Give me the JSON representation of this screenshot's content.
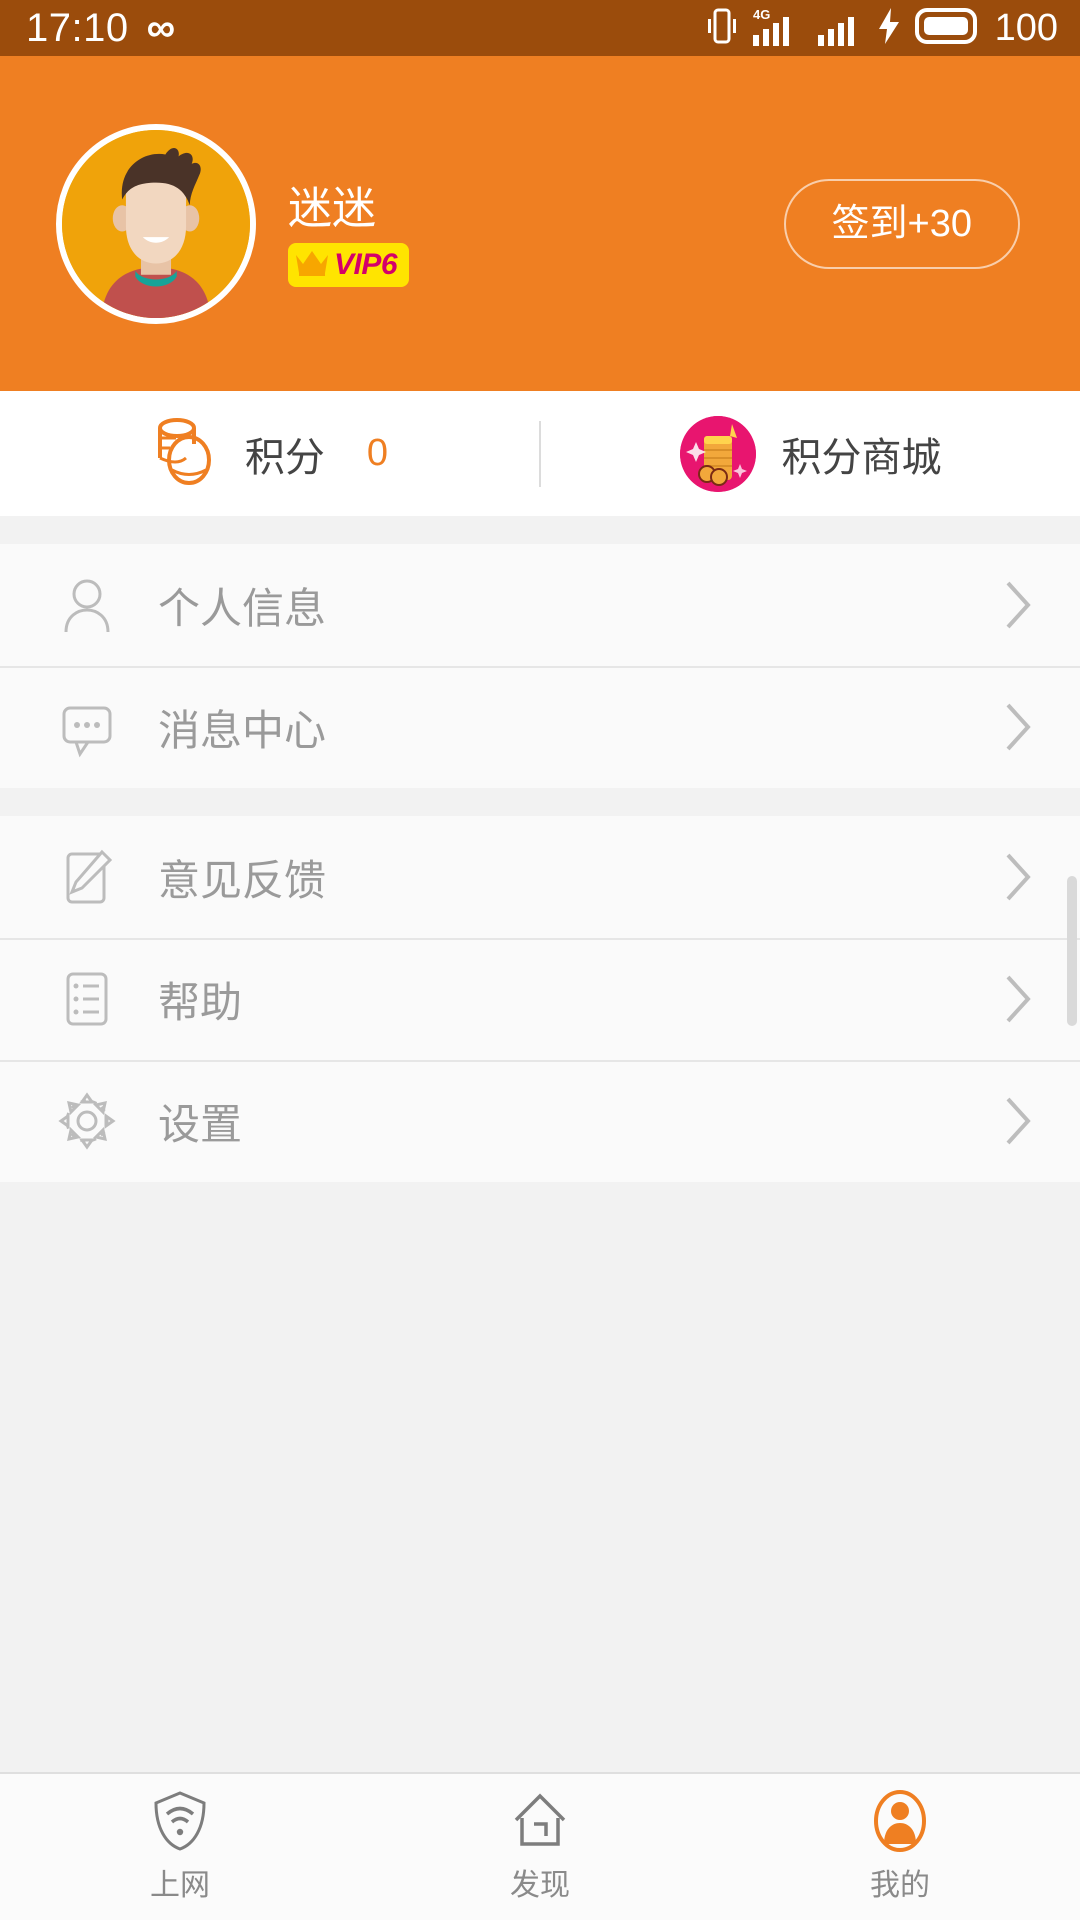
{
  "statusbar": {
    "time": "17:10",
    "infinity_icon": "infinity-icon",
    "vibrate_icon": "vibrate-icon",
    "signal_4g_icon": "signal-4g-icon",
    "signal_icon": "signal-bars-icon",
    "charging_icon": "charging-bolt-icon",
    "battery_icon": "battery-icon",
    "battery_level": "100",
    "bg_color": "#9b4c0c"
  },
  "profile": {
    "bg_color": "#ef7f22",
    "avatar_name": "user-avatar",
    "username": "迷迷",
    "vip": {
      "label": "VIP6",
      "crown_icon": "crown-icon",
      "bg_color": "#ffe400",
      "text_color": "#d4006a"
    },
    "checkin_label": "签到+30"
  },
  "points": {
    "coins_icon": "coins-icon",
    "label": "积分",
    "value": "0",
    "value_color": "#ef7f22",
    "mall_icon": "points-mall-icon",
    "mall_label": "积分商城"
  },
  "menu": {
    "groups": [
      {
        "items": [
          {
            "icon": "person-icon",
            "label": "个人信息",
            "chevron": "chevron-right-icon"
          },
          {
            "icon": "message-icon",
            "label": "消息中心",
            "chevron": "chevron-right-icon"
          }
        ]
      },
      {
        "items": [
          {
            "icon": "edit-icon",
            "label": "意见反馈",
            "chevron": "chevron-right-icon"
          },
          {
            "icon": "list-icon",
            "label": "帮助",
            "chevron": "chevron-right-icon"
          },
          {
            "icon": "gear-icon",
            "label": "设置",
            "chevron": "chevron-right-icon"
          }
        ]
      }
    ]
  },
  "bottomnav": {
    "active_color": "#ef7f22",
    "items": [
      {
        "icon": "shield-wifi-icon",
        "label": "上网",
        "active": false
      },
      {
        "icon": "home-icon",
        "label": "发现",
        "active": false
      },
      {
        "icon": "person-filled-icon",
        "label": "我的",
        "active": true
      }
    ]
  }
}
